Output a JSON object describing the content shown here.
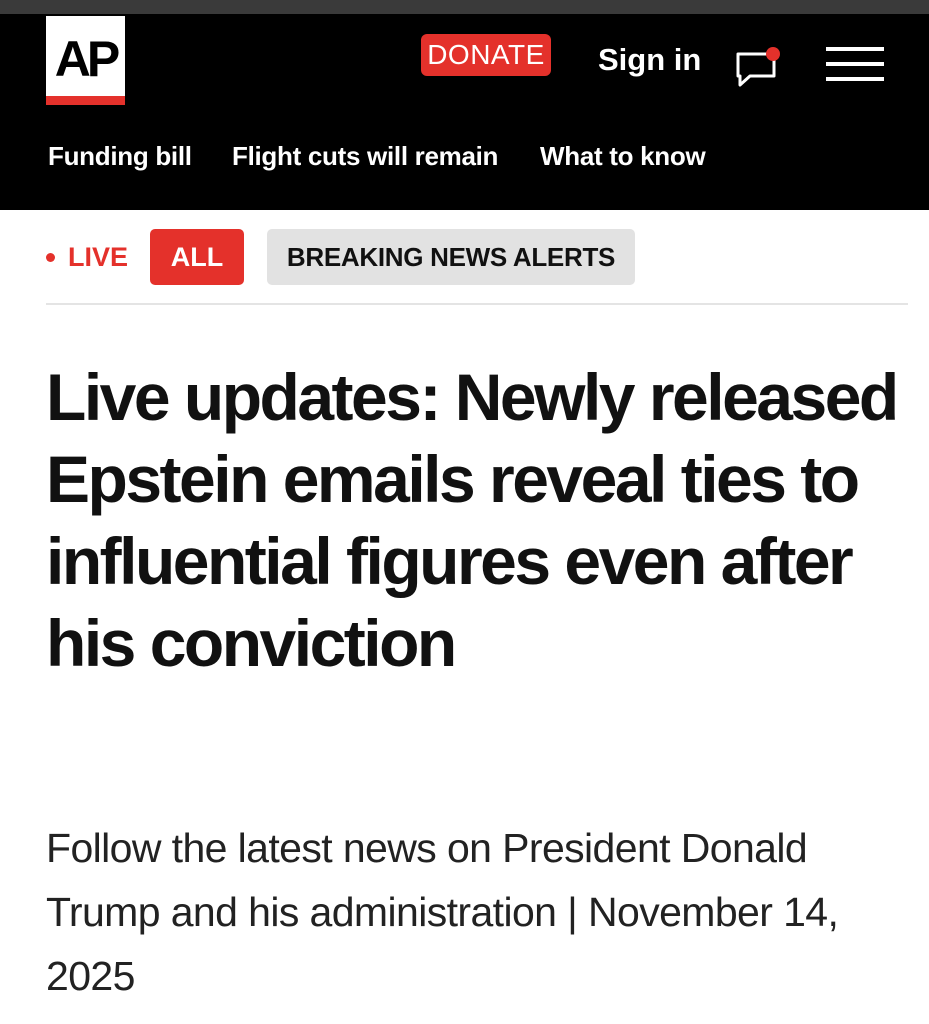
{
  "header": {
    "logo_text": "AP",
    "donate_label": "DONATE",
    "sign_in_label": "Sign in",
    "icons": {
      "chat": "chat-bubble-notification-icon",
      "menu": "hamburger-menu-icon"
    },
    "colors": {
      "brand_red": "#e4312b",
      "bar_background": "#000000"
    }
  },
  "subnav": {
    "items": [
      {
        "label": "Funding bill"
      },
      {
        "label": "Flight cuts will remain"
      },
      {
        "label": "What to know"
      }
    ]
  },
  "filters": {
    "live_label": "LIVE",
    "all_label": "ALL",
    "breaking_label": "BREAKING NEWS ALERTS"
  },
  "article": {
    "headline": "Live updates: Newly released Epstein emails reveal ties to influential figures even after his conviction",
    "summary": "Follow the latest news on President Donald Trump and his administration | November 14, 2025"
  }
}
